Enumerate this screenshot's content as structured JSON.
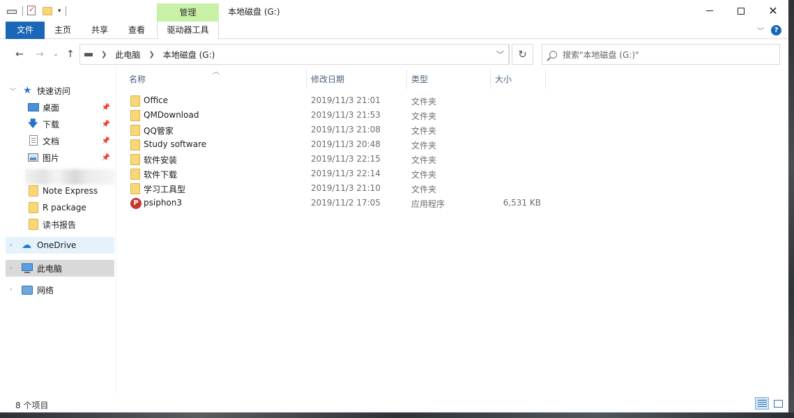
{
  "window": {
    "title": "本地磁盘 (G:)",
    "context_tab_header": "管理"
  },
  "ribbon": {
    "tabs": [
      "文件",
      "主页",
      "共享",
      "查看"
    ],
    "context_tab": "驱动器工具"
  },
  "nav": {
    "breadcrumb": [
      "此电脑",
      "本地磁盘 (G:)"
    ],
    "search_placeholder": "搜索\"本地磁盘 (G:)\""
  },
  "sidebar": {
    "quick_access": "快速访问",
    "items": [
      {
        "label": "桌面",
        "icon": "desktop-icon"
      },
      {
        "label": "下载",
        "icon": "download-icon"
      },
      {
        "label": "文档",
        "icon": "document-icon"
      },
      {
        "label": "图片",
        "icon": "pictures-icon"
      },
      {
        "label": "Note Express",
        "icon": "folder-icon"
      },
      {
        "label": "R package",
        "icon": "folder-icon"
      },
      {
        "label": "读书报告",
        "icon": "folder-icon"
      }
    ],
    "onedrive": "OneDrive",
    "this_pc": "此电脑",
    "network": "网络"
  },
  "columns": {
    "name": "名称",
    "date": "修改日期",
    "type": "类型",
    "size": "大小"
  },
  "files": [
    {
      "name": "Office",
      "date": "2019/11/3 21:01",
      "type": "文件夹",
      "size": "",
      "icon": "folder-icon"
    },
    {
      "name": "QMDownload",
      "date": "2019/11/3 21:53",
      "type": "文件夹",
      "size": "",
      "icon": "folder-icon"
    },
    {
      "name": "QQ管家",
      "date": "2019/11/3 21:08",
      "type": "文件夹",
      "size": "",
      "icon": "folder-icon"
    },
    {
      "name": "Study software",
      "date": "2019/11/3 20:48",
      "type": "文件夹",
      "size": "",
      "icon": "folder-icon"
    },
    {
      "name": "软件安装",
      "date": "2019/11/3 22:15",
      "type": "文件夹",
      "size": "",
      "icon": "folder-icon"
    },
    {
      "name": "软件下载",
      "date": "2019/11/3 22:14",
      "type": "文件夹",
      "size": "",
      "icon": "folder-icon"
    },
    {
      "name": "学习工具型",
      "date": "2019/11/3 21:10",
      "type": "文件夹",
      "size": "",
      "icon": "folder-icon"
    },
    {
      "name": "psiphon3",
      "date": "2019/11/2 17:05",
      "type": "应用程序",
      "size": "6,531 KB",
      "icon": "app-icon"
    }
  ],
  "status": {
    "item_count": "8 个项目"
  },
  "colors": {
    "file_tab": "#1a66b8",
    "context_tab": "#c8f0a6",
    "selection": "#e5f1fb",
    "folder": "#f8d775"
  }
}
